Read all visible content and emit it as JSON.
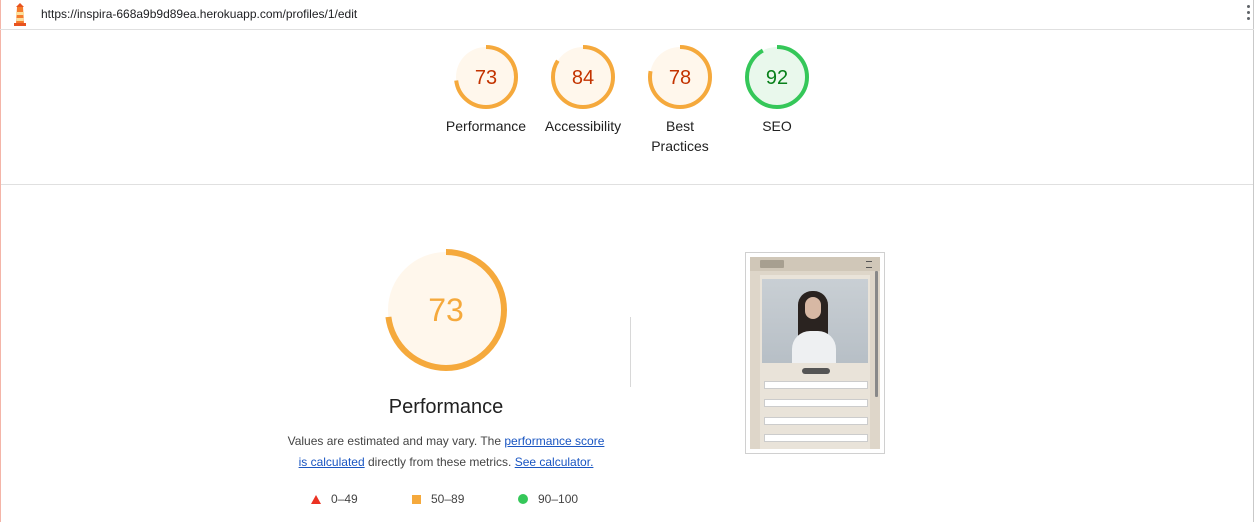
{
  "browser": {
    "url": "https://inspira-668a9b9d89ea.herokuapp.com/profiles/1/edit"
  },
  "colors": {
    "average": "#f5a93c",
    "average_text": "#c33300",
    "average_bg": "#fff7ec",
    "pass": "#35c759",
    "pass_text": "#08801a",
    "pass_bg": "#e9f8ec",
    "fail": "#eb3223",
    "link": "#1a56c2"
  },
  "scores": [
    {
      "label": "Performance",
      "value": 73,
      "status": "average"
    },
    {
      "label": "Accessibility",
      "value": 84,
      "status": "average"
    },
    {
      "label_line1": "Best",
      "label_line2": "Practices",
      "value": 78,
      "status": "average"
    },
    {
      "label": "SEO",
      "value": 92,
      "status": "pass"
    }
  ],
  "performance": {
    "score": 73,
    "title": "Performance",
    "desc_prefix": "Values are estimated and may vary. The ",
    "link_score": "performance score",
    "link_calculated": "is calculated",
    "desc_middle": " directly from these metrics. ",
    "link_calculator": "See calculator."
  },
  "legend": [
    {
      "icon": "red-triangle-icon",
      "range": "0–49"
    },
    {
      "icon": "orange-square-icon",
      "range": "50–89"
    },
    {
      "icon": "green-circle-icon",
      "range": "90–100"
    }
  ]
}
